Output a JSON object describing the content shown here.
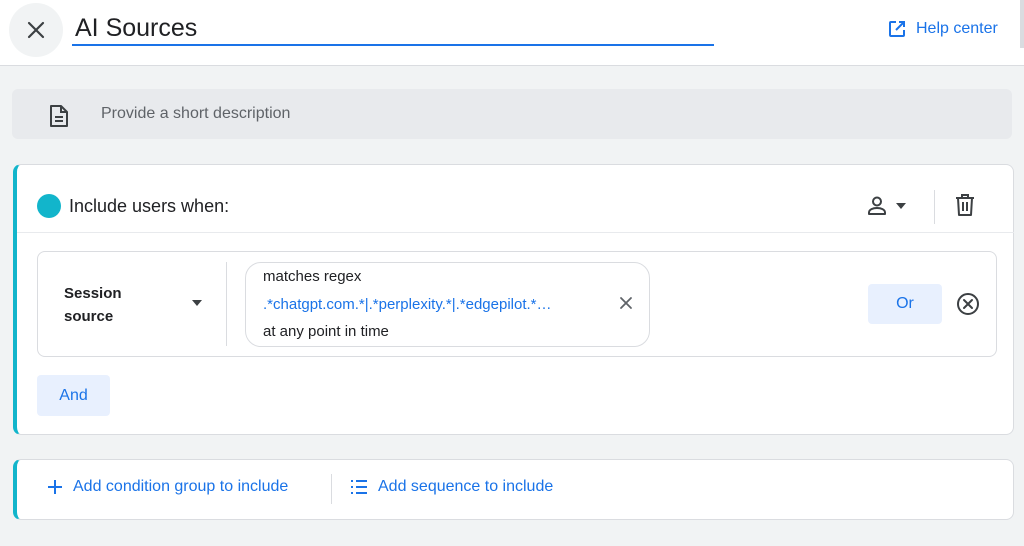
{
  "header": {
    "title": "AI Sources",
    "help_label": "Help center"
  },
  "description": {
    "placeholder": "Provide a short description"
  },
  "include_group": {
    "label": "Include users when:",
    "condition": {
      "dimension": [
        "Session",
        "source"
      ],
      "operator": "matches regex",
      "value": ".*chatgpt.com.*|.*perplexity.*|.*edgepilot.*…",
      "scope": "at any point in time",
      "or_label": "Or"
    },
    "and_label": "And"
  },
  "add_actions": {
    "condition_group_label": "Add condition group to include",
    "sequence_label": "Add sequence to include"
  },
  "colors": {
    "accent": "#1a73e8",
    "group_stripe": "#12b5cb",
    "button_bg": "#e8f0fe"
  },
  "icons": [
    "close-icon",
    "open-in-new-icon",
    "document-icon",
    "person-icon",
    "caret-down-icon",
    "trash-icon",
    "clear-icon",
    "cancel-circle-icon",
    "plus-icon",
    "sequence-list-icon"
  ]
}
